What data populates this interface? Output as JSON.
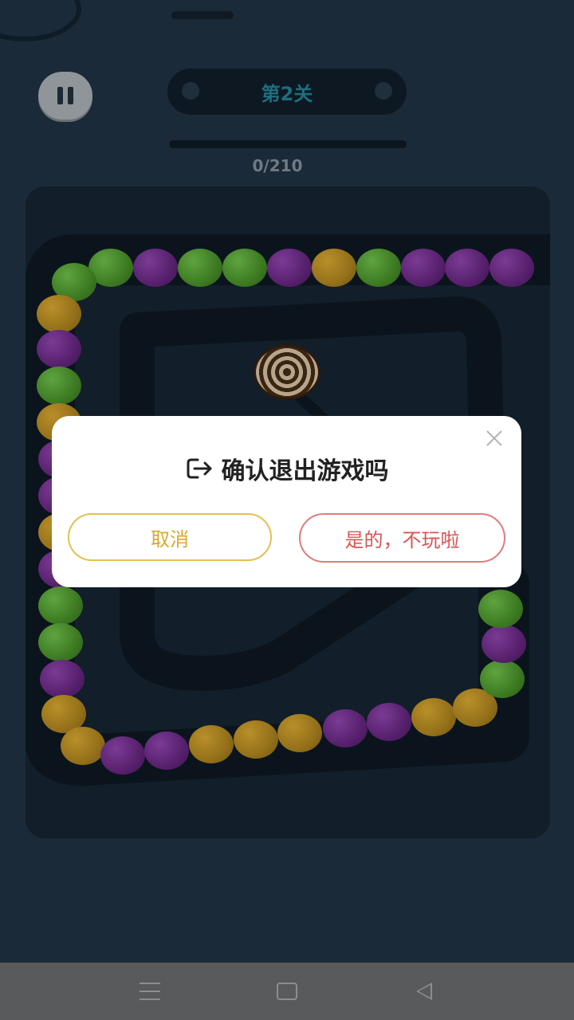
{
  "hud": {
    "level_label": "第2关",
    "score_text": "0/210",
    "progress_fraction": 0
  },
  "dialog": {
    "title": "确认退出游戏吗",
    "cancel_label": "取消",
    "confirm_label": "是的，不玩啦",
    "close_icon": "close-icon",
    "title_icon": "exit-icon"
  },
  "marble_colors": {
    "green": "#3d7a22",
    "purple": "#57206d",
    "orange": "#94701a"
  },
  "marbles": [
    "purple",
    "purple",
    "purple",
    "green",
    "orange",
    "purple",
    "green",
    "green",
    "purple",
    "green",
    "green",
    "orange",
    "purple",
    "green",
    "orange",
    "purple",
    "purple",
    "orange",
    "purple",
    "green",
    "green",
    "purple",
    "orange",
    "orange",
    "purple",
    "purple",
    "orange",
    "orange",
    "orange",
    "purple",
    "purple",
    "orange",
    "orange",
    "green",
    "purple",
    "green"
  ],
  "nav": {
    "menu_icon": "menu-icon",
    "home_icon": "home-icon",
    "back_icon": "back-icon"
  }
}
